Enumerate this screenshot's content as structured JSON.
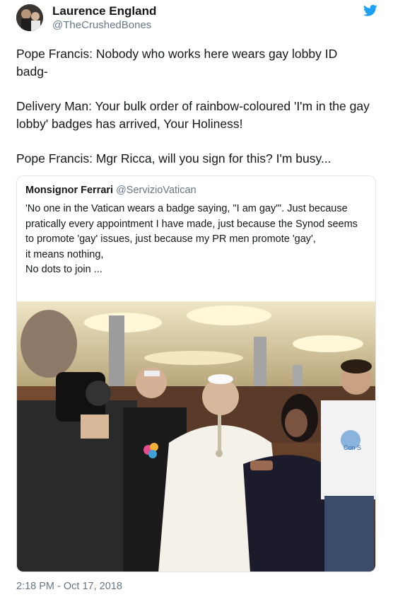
{
  "author": {
    "display_name": "Laurence England",
    "handle": "@TheCrushedBones"
  },
  "tweet": {
    "paragraphs": [
      "Pope Francis: Nobody who works here wears gay lobby ID badg-",
      "Delivery Man: Your bulk order of rainbow-coloured  'I'm in the gay lobby' badges has arrived, Your Holiness!",
      "Pope Francis: Mgr Ricca, will you sign for this? I'm busy..."
    ],
    "timestamp": "2:18 PM - Oct 17, 2018"
  },
  "quoted_tweet": {
    "display_name": "Monsignor Ferrari",
    "handle": "@ServizioVatican",
    "text": "'No one in the Vatican wears a badge saying, \"I am gay\"'. Just because pratically every appointment I have made, just because the Synod seems to promote 'gay' issues, just because my PR men promote 'gay',\nit means nothing,\nNo dots to join ...",
    "photo_caption_text": "Con S"
  },
  "icons": {
    "brand": "twitter-bird-icon",
    "avatar": "avatar"
  },
  "colors": {
    "twitter_blue": "#1da1f2",
    "secondary_text": "#657786",
    "primary_text": "#14171a",
    "border": "#e1e8ed"
  }
}
